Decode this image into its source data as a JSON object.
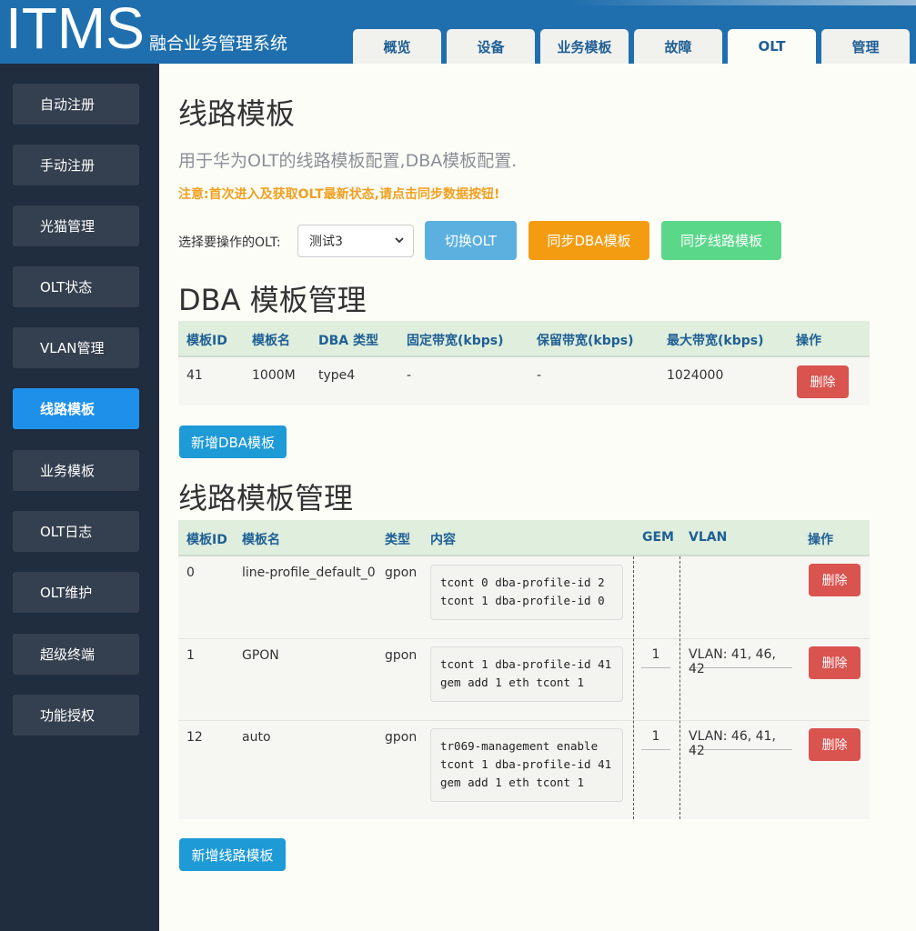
{
  "header": {
    "logo": "ITMS",
    "subtitle": "融合业务管理系统",
    "tabs": [
      "概览",
      "设备",
      "业务模板",
      "故障",
      "OLT",
      "管理"
    ],
    "active_tab": "OLT"
  },
  "sidebar": {
    "items": [
      "自动注册",
      "手动注册",
      "光猫管理",
      "OLT状态",
      "VLAN管理",
      "线路模板",
      "业务模板",
      "OLT日志",
      "OLT维护",
      "超级终端",
      "功能授权"
    ],
    "active": "线路模板"
  },
  "page": {
    "title": "线路模板",
    "description": "用于华为OLT的线路模板配置,DBA模板配置.",
    "notice": "注意:首次进入及获取OLT最新状态,请点击同步数据按钮!"
  },
  "toolbar": {
    "select_label": "选择要操作的OLT:",
    "select_value": "测试3",
    "switch_label": "切换OLT",
    "sync_dba_label": "同步DBA模板",
    "sync_line_label": "同步线路模板"
  },
  "dba": {
    "heading": "DBA 模板管理",
    "columns": [
      "模板ID",
      "模板名",
      "DBA 类型",
      "固定带宽(kbps)",
      "保留带宽(kbps)",
      "最大带宽(kbps)",
      "操作"
    ],
    "rows": [
      {
        "id": "41",
        "name": "1000M",
        "type": "type4",
        "fixed": "-",
        "assured": "-",
        "max": "1024000",
        "action": "删除"
      }
    ],
    "add_label": "新增DBA模板"
  },
  "line": {
    "heading": "线路模板管理",
    "columns": [
      "模板ID",
      "模板名",
      "类型",
      "内容",
      "GEM",
      "VLAN",
      "操作"
    ],
    "rows": [
      {
        "id": "0",
        "name": "line-profile_default_0",
        "type": "gpon",
        "content": "tcont 0 dba-profile-id 2\ntcont 1 dba-profile-id 0",
        "gem": "",
        "vlan": "",
        "action": "删除"
      },
      {
        "id": "1",
        "name": "GPON",
        "type": "gpon",
        "content": "tcont 1 dba-profile-id 41\ngem add 1 eth tcont 1",
        "gem": "1",
        "vlan": "VLAN: 41, 46, 42",
        "action": "删除"
      },
      {
        "id": "12",
        "name": "auto",
        "type": "gpon",
        "content": "tr069-management enable\ntcont 1 dba-profile-id 41\ngem add 1 eth tcont 1",
        "gem": "1",
        "vlan": "VLAN: 46, 41, 42",
        "action": "删除"
      }
    ],
    "add_label": "新增线路模板"
  }
}
